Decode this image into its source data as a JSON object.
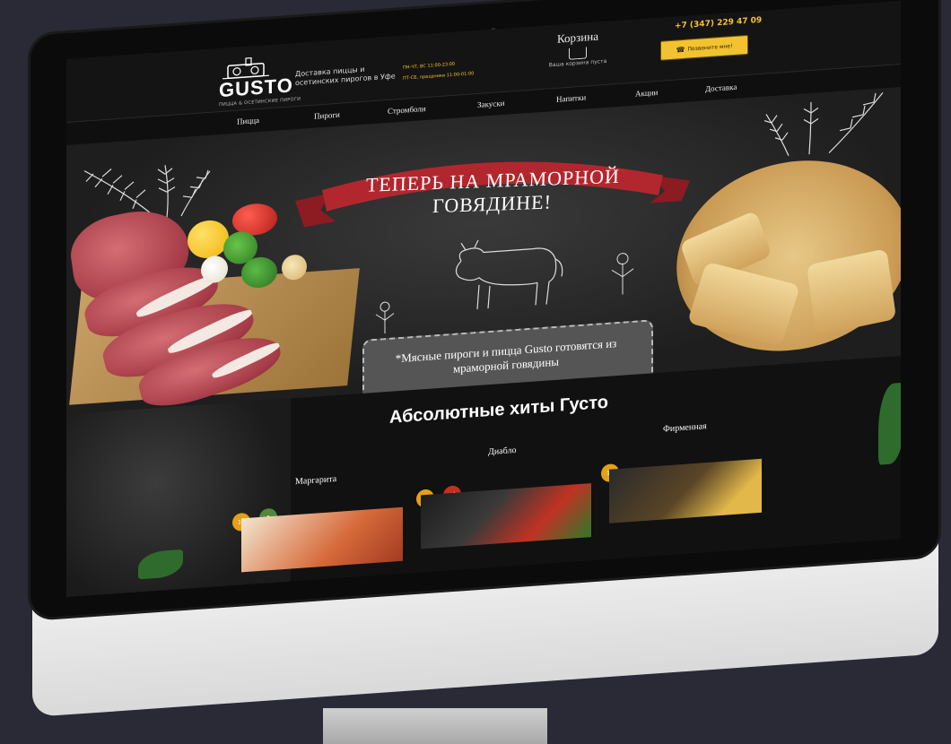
{
  "header": {
    "logo_text": "GUSTO",
    "logo_tagline": "ПИЦЦА & ОСЕТИНСКИЕ ПИРОГИ",
    "tagline": "Доставка пиццы и осетинских пирогов в Уфе",
    "hours_1": "ПН-ЧТ, ВС 11:00-23:00",
    "hours_2": "ПТ-СБ, праздники 11:00-01:00",
    "cart_title": "Корзина",
    "cart_status": "Ваша корзина пуста",
    "phone": "+7 (347) 229 47 09",
    "callback_label": "Позвоните мне!"
  },
  "nav": [
    "Пицца",
    "Пироги",
    "Стромболи",
    "Закуски",
    "Напитки",
    "Акции",
    "Доставка"
  ],
  "hero": {
    "banner": "ТЕПЕРЬ НА МРАМОРНОЙ ГОВЯДИНЕ!",
    "note": "*Мясные пироги и пицца Gusto готовятся из мраморной говядины"
  },
  "hits": {
    "title": "Абсолютные хиты Густо",
    "products": [
      {
        "name": "Маргарита"
      },
      {
        "name": "Диабло"
      },
      {
        "name": "Фирменная"
      }
    ]
  },
  "colors": {
    "accent": "#f2c230",
    "ribbon": "#b2272e",
    "background": "#1b1b1b"
  }
}
